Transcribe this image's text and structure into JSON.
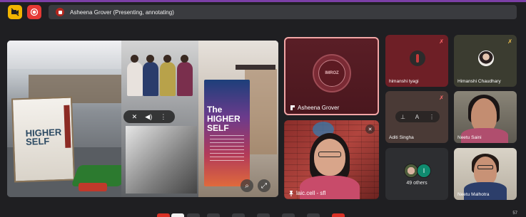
{
  "header": {
    "camera_icon": "camera-off-icon",
    "record_icon": "record-icon",
    "presenting_label": "Asheena Grover (Presenting, annotating)"
  },
  "presentation": {
    "poster_title_left": "HIGHER SELF",
    "poster_title_right": "The HIGHER SELF",
    "controls": [
      "mic-off-icon",
      "volume-icon",
      "more-icon"
    ],
    "zoom_controls": [
      "zoom-icon",
      "fullscreen-icon"
    ]
  },
  "tiles": {
    "asheena": {
      "name": "Asheena Grover",
      "avatar_text": "IMROZ"
    },
    "laic": {
      "name": "laic.cell - sfl"
    },
    "himanshi_t": {
      "name": "himanshi tyagi"
    },
    "himanshi_c": {
      "name": "Himanshi Chaudhary"
    },
    "aditi": {
      "name": "Aditi Singha"
    },
    "neetu_s": {
      "name": "Neetu Saini"
    },
    "others": {
      "count_label": "49 others",
      "avatar_letter": "I"
    },
    "neetu_m": {
      "name": "Neetu Malhotra"
    }
  },
  "footer": {
    "count": "57"
  },
  "colors": {
    "accent": "#7b3fa6",
    "record": "#e53935",
    "camera": "#f2b400",
    "presenter_border": "#f2a6a6"
  }
}
